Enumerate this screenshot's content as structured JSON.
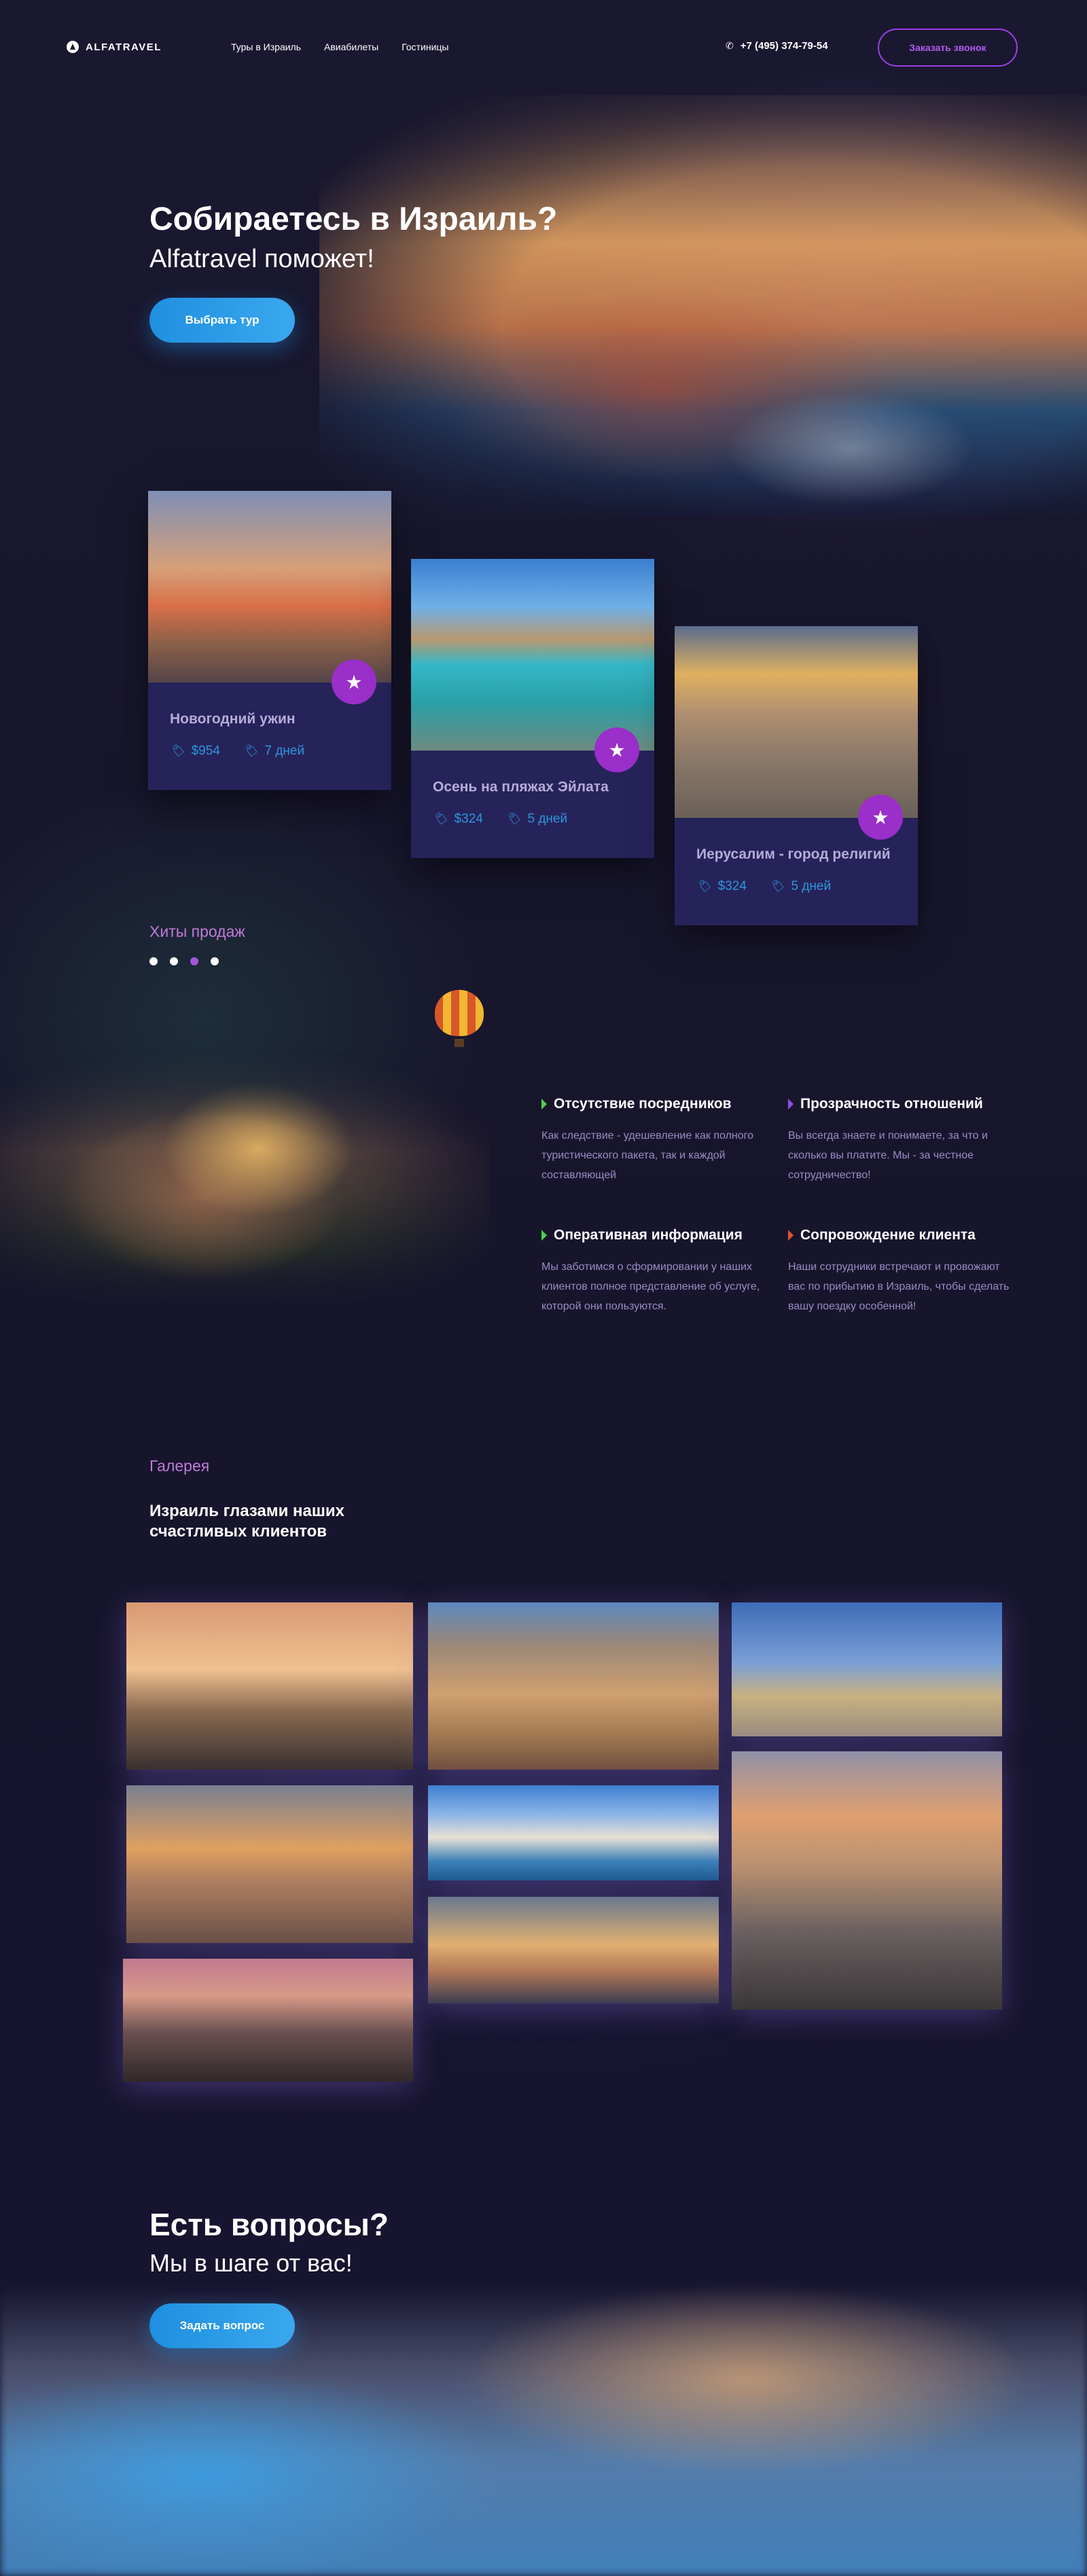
{
  "header": {
    "logo": "ALFATRAVEL",
    "nav": [
      "Туры в Израиль",
      "Авиабилеты",
      "Гостиницы"
    ],
    "phone": "+7 (495) 374-79-54",
    "call_button": "Заказать звонок"
  },
  "hero": {
    "title": "Собираетесь в Израиль?",
    "subtitle": "Alfatravel поможет!",
    "button": "Выбрать тур"
  },
  "tours": [
    {
      "title": "Новогодний ужин",
      "price": "$954",
      "duration": "7 дней"
    },
    {
      "title": "Осень на пляжах Эйлата",
      "price": "$324",
      "duration": "5 дней"
    },
    {
      "title": "Иерусалим - город религий",
      "price": "$324",
      "duration": "5 дней"
    }
  ],
  "hits": {
    "label": "Хиты продаж",
    "dots": 4,
    "active_dot": 3
  },
  "features": [
    {
      "title": "Отсутствие посредников",
      "text": "Как следствие - удешевление как полного туристического пакета, так и каждой составляющей",
      "color": "#4cd04c"
    },
    {
      "title": "Прозрачность отношений",
      "text": "Вы всегда знаете и понимаете, за что и сколько вы платите. Мы - за честное сотрудничество!",
      "color": "#8a52e0"
    },
    {
      "title": "Оперативная информация",
      "text": "Мы заботимся о сформировании у наших клиентов полное представление об услуге, которой они пользуются.",
      "color": "#4cd04c"
    },
    {
      "title": "Сопровождение клиента",
      "text": "Наши сотрудники встречают и провожают вас по прибытию в Израиль, чтобы сделать вашу поездку особенной!",
      "color": "#e0542a"
    }
  ],
  "gallery": {
    "label": "Галерея",
    "title": "Израиль глазами наших счастливых клиентов"
  },
  "contact": {
    "title": "Есть вопросы?",
    "subtitle": "Мы в шаге от вас!",
    "button": "Задать вопрос"
  },
  "colors": {
    "accent_purple": "#9a2fc9",
    "accent_blue": "#1f8fe0",
    "card_bg": "#26235a",
    "page_bg": "#16142b"
  }
}
